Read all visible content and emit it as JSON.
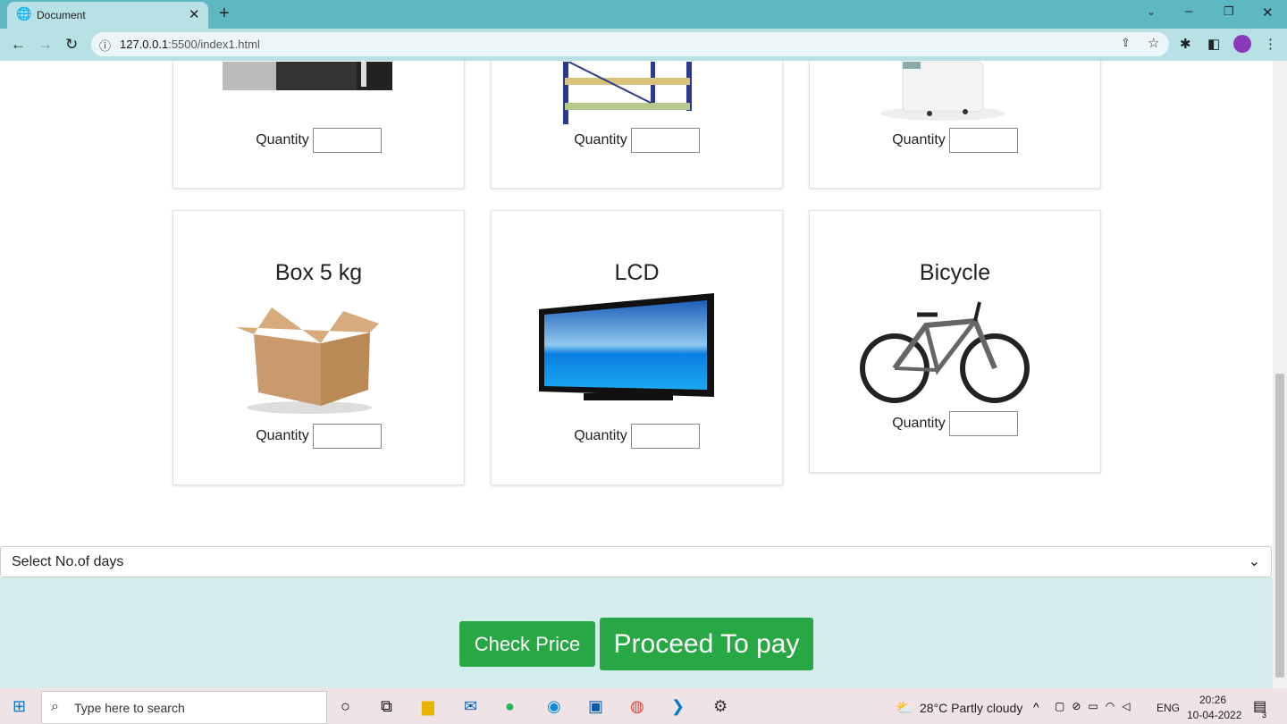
{
  "browser": {
    "tab_title": "Document",
    "url": "127.0.0.1:5500/index1.html",
    "url_host": "127.0.0.1",
    "url_rest": ":5500/index1.html"
  },
  "products_top": [
    {
      "quantity_label": "Quantity"
    },
    {
      "quantity_label": "Quantity"
    },
    {
      "quantity_label": "Quantity"
    }
  ],
  "products": [
    {
      "name": "Box 5 kg",
      "quantity_label": "Quantity"
    },
    {
      "name": "LCD",
      "quantity_label": "Quantity"
    },
    {
      "name": "Bicycle",
      "quantity_label": "Quantity"
    }
  ],
  "days_select": {
    "selected": "Select No.of days"
  },
  "buttons": {
    "check_price": "Check Price",
    "proceed": "Proceed To pay"
  },
  "accent": "#28a745",
  "taskbar": {
    "search_placeholder": "Type here to search",
    "weather": "28°C  Partly cloudy",
    "lang": "ENG",
    "time": "20:26",
    "date": "10-04-2022",
    "notifications": "3"
  }
}
